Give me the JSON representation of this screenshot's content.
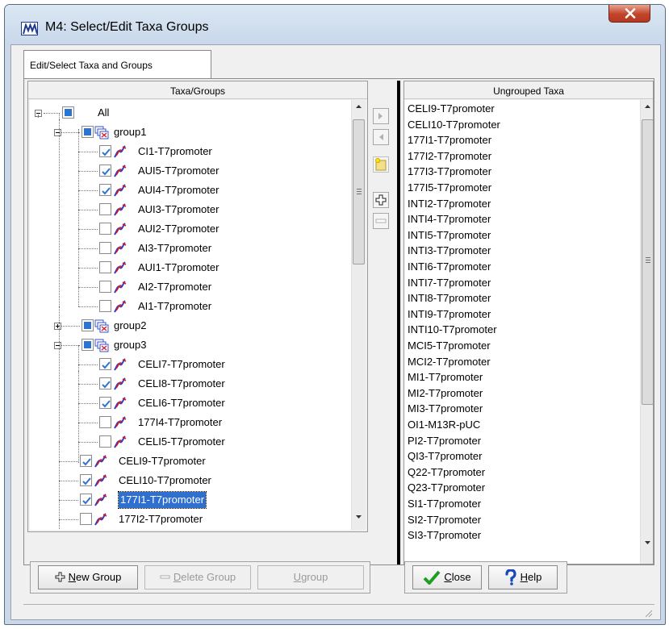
{
  "window": {
    "title": "M4: Select/Edit Taxa Groups",
    "close_glyph": "x"
  },
  "tabs": [
    {
      "label": "Edit/Select Taxa and Groups",
      "active": true
    }
  ],
  "taxa_groups_panel": {
    "header": "Taxa/Groups",
    "tree": [
      {
        "label": "All",
        "type": "root",
        "state": "partial",
        "expanded": true
      },
      {
        "label": "group1",
        "type": "group",
        "state": "partial",
        "expanded": true
      },
      {
        "label": "CI1-T7promoter",
        "type": "taxon",
        "checked": true
      },
      {
        "label": "AUI5-T7promoter",
        "type": "taxon",
        "checked": true
      },
      {
        "label": "AUI4-T7promoter",
        "type": "taxon",
        "checked": true
      },
      {
        "label": "AUI3-T7promoter",
        "type": "taxon",
        "checked": false
      },
      {
        "label": "AUI2-T7promoter",
        "type": "taxon",
        "checked": false
      },
      {
        "label": "AI3-T7promoter",
        "type": "taxon",
        "checked": false
      },
      {
        "label": "AUI1-T7promoter",
        "type": "taxon",
        "checked": false
      },
      {
        "label": "AI2-T7promoter",
        "type": "taxon",
        "checked": false
      },
      {
        "label": "AI1-T7promoter",
        "type": "taxon",
        "checked": false
      },
      {
        "label": "group2",
        "type": "group",
        "state": "partial",
        "expanded": false
      },
      {
        "label": "group3",
        "type": "group",
        "state": "partial",
        "expanded": true
      },
      {
        "label": "CELI7-T7promoter",
        "type": "taxon",
        "checked": true
      },
      {
        "label": "CELI8-T7promoter",
        "type": "taxon",
        "checked": true
      },
      {
        "label": "CELI6-T7promoter",
        "type": "taxon",
        "checked": true
      },
      {
        "label": "177I4-T7promoter",
        "type": "taxon",
        "checked": false
      },
      {
        "label": "CELI5-T7promoter",
        "type": "taxon",
        "checked": false
      },
      {
        "label": "CELI9-T7promoter",
        "type": "ungrouped-taxon",
        "checked": true
      },
      {
        "label": "CELI10-T7promoter",
        "type": "ungrouped-taxon",
        "checked": true
      },
      {
        "label": "177I1-T7promoter",
        "type": "ungrouped-taxon",
        "checked": true,
        "selected": true
      },
      {
        "label": "177I2-T7promoter",
        "type": "ungrouped-taxon",
        "checked": false
      }
    ]
  },
  "middle_toolbar": {
    "buttons": [
      {
        "icon": "arrow-right-icon",
        "enabled": false
      },
      {
        "icon": "arrow-left-icon",
        "enabled": false
      },
      {
        "icon": "new-folder-icon",
        "enabled": true
      },
      {
        "icon": "plus-icon",
        "enabled": true
      },
      {
        "icon": "minus-icon",
        "enabled": false
      }
    ]
  },
  "ungrouped_panel": {
    "header": "Ungrouped Taxa",
    "items": [
      "CELI9-T7promoter",
      "CELI10-T7promoter",
      "177I1-T7promoter",
      "177I2-T7promoter",
      "177I3-T7promoter",
      "177I5-T7promoter",
      "INTI2-T7promoter",
      "INTI4-T7promoter",
      "INTI5-T7promoter",
      "INTI3-T7promoter",
      "INTI6-T7promoter",
      "INTI7-T7promoter",
      "INTI8-T7promoter",
      "INTI9-T7promoter",
      "INTI10-T7promoter",
      "MCI5-T7promoter",
      "MCI2-T7promoter",
      "MI1-T7promoter",
      "MI2-T7promoter",
      "MI3-T7promoter",
      "OI1-M13R-pUC",
      "PI2-T7promoter",
      "QI3-T7promoter",
      "Q22-T7promoter",
      "Q23-T7promoter",
      "SI1-T7promoter",
      "SI2-T7promoter",
      "SI3-T7promoter"
    ]
  },
  "buttons": {
    "new_group": {
      "prefix": "N",
      "rest": "ew Group",
      "enabled": true
    },
    "delete_group": {
      "prefix": "D",
      "rest": "elete Group",
      "enabled": false
    },
    "ugroup": {
      "prefix": "U",
      "rest": "group",
      "enabled": false
    },
    "close": {
      "prefix": "C",
      "rest": "lose",
      "enabled": true
    },
    "help": {
      "prefix": "H",
      "rest": "elp",
      "enabled": true
    }
  },
  "colors": {
    "selection": "#2f6fd0",
    "checkbox_fill": "#2c73d2",
    "title_close": "#c2442b"
  }
}
